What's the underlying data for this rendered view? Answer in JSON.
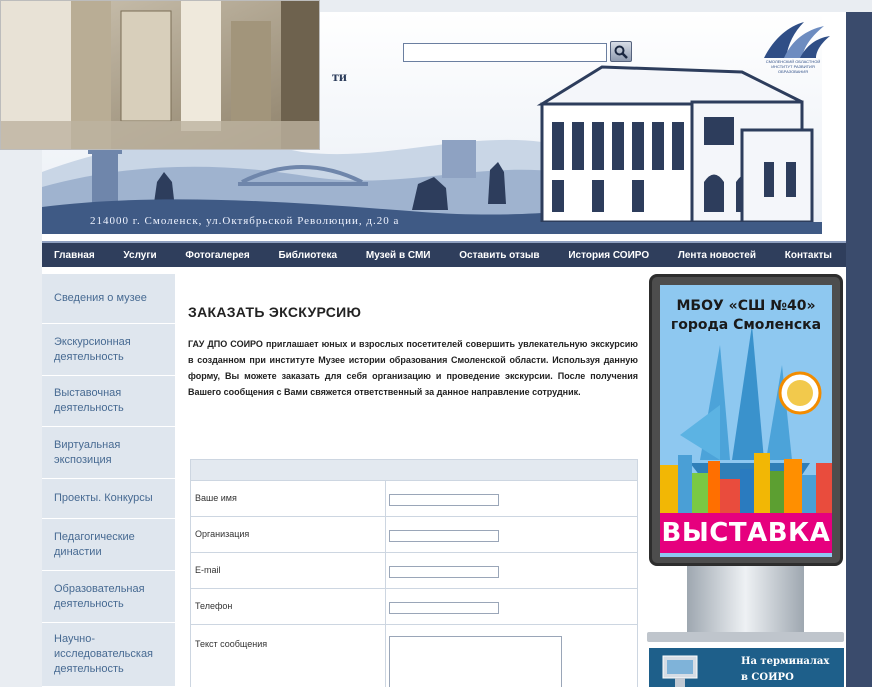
{
  "header": {
    "address": "214000 г. Смоленск, ул.Октябрьской Революции, д.20 а",
    "search_placeholder": "",
    "title_fragment": "ти",
    "logo_text": "СМОЛЕНСКИЙ ОБЛАСТНОЙ ИНСТИТУТ РАЗВИТИЯ ОБРАЗОВАНИЯ"
  },
  "nav": {
    "items": [
      {
        "label": "Главная"
      },
      {
        "label": "Услуги"
      },
      {
        "label": "Фотогалерея"
      },
      {
        "label": "Библиотека"
      },
      {
        "label": "Музей в СМИ"
      },
      {
        "label": "Оставить отзыв"
      },
      {
        "label": "История СОИРО"
      },
      {
        "label": "Лента новостей"
      },
      {
        "label": "Контакты"
      }
    ]
  },
  "sidebar": {
    "items": [
      {
        "label": "Сведения о музее"
      },
      {
        "label": "Экскурсионная деятельность"
      },
      {
        "label": "Выставочная деятельность"
      },
      {
        "label": "Виртуальная экспозиция"
      },
      {
        "label": "Проекты. Конкурсы"
      },
      {
        "label": "Педагогические династии"
      },
      {
        "label": "Образовательная деятельность"
      },
      {
        "label": "Научно-исследовательская деятельность"
      }
    ]
  },
  "main": {
    "title": "ЗАКАЗАТЬ ЭКСКУРСИЮ",
    "intro": "ГАУ ДПО СОИРО приглашает юных и взрослых посетителей совершить увлекательную экскурсию в созданном при институте Музее истории образования Смоленской области. Используя данную форму, Вы можете заказать для себя организацию и проведение экскурсии. После получения Вашего сообщения с Вами свяжется ответственный за данное направление сотрудник.",
    "form": {
      "fields": [
        {
          "label": "Ваше имя",
          "value": ""
        },
        {
          "label": "Организация",
          "value": ""
        },
        {
          "label": "E-mail",
          "value": ""
        },
        {
          "label": "Телефон",
          "value": ""
        },
        {
          "label": "Текст сообщения",
          "value": ""
        }
      ]
    }
  },
  "poster": {
    "title_line1": "МБОУ «СШ №40»",
    "title_line2": "города Смоленска",
    "banner": "ВЫСТАВКА",
    "terminal_line1": "На терминалах",
    "terminal_line2": "в СОИРО"
  },
  "colors": {
    "nav_bg": "#2f3e5c",
    "sidebar_bg": "#dfe6ee",
    "sidebar_text": "#476a92",
    "header_blue": "#3f5a85",
    "poster_banner": "#e6007e"
  }
}
